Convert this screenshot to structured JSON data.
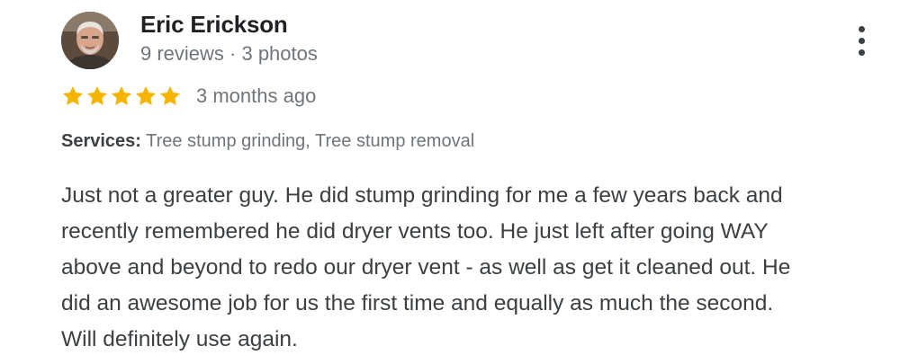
{
  "reviewer": {
    "name": "Eric Erickson",
    "meta": "9 reviews · 3 photos"
  },
  "rating": {
    "stars": 5,
    "max": 5,
    "time": "3 months ago",
    "star_color": "#f4b400"
  },
  "services": {
    "label": "Services:",
    "value": "Tree stump grinding, Tree stump removal"
  },
  "review_text": {
    "lines": [
      "Just not a greater guy. He did stump grinding for me a few years back and",
      "recently remembered he did dryer vents too. He just left after going WAY",
      "above and beyond to redo our dryer vent - as well as get it cleaned out. He",
      "did an awesome job for us the first time and equally as much the second.",
      "Will definitely use again."
    ]
  },
  "icons": {
    "more": "more-vert-icon",
    "star": "star-icon",
    "avatar": "profile-photo"
  }
}
